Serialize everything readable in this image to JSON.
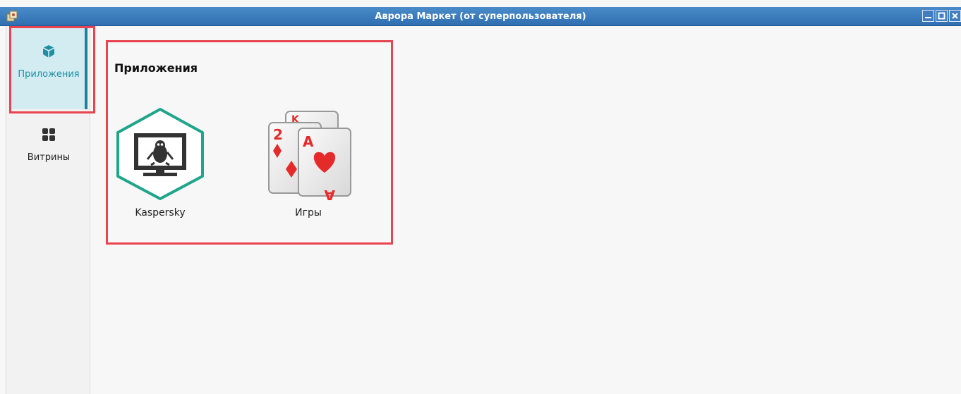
{
  "window": {
    "title": "Аврора Маркет (от суперпользователя)"
  },
  "sidebar": {
    "items": [
      {
        "label": "Приложения",
        "icon": "box-icon",
        "active": true
      },
      {
        "label": "Витрины",
        "icon": "grid-icon",
        "active": false
      }
    ]
  },
  "main": {
    "section_title": "Приложения",
    "apps": [
      {
        "label": "Kaspersky",
        "icon": "kaspersky-penguin-monitor-icon"
      },
      {
        "label": "Игры",
        "icon": "playing-cards-icon"
      }
    ]
  },
  "colors": {
    "titlebar": "#2f6fb1",
    "accent": "#1f8fa3",
    "active_bg": "#d3ecf1",
    "highlight_outline": "#e8434e",
    "kaspersky_green": "#1fa58a",
    "card_red": "#e52a2a"
  }
}
